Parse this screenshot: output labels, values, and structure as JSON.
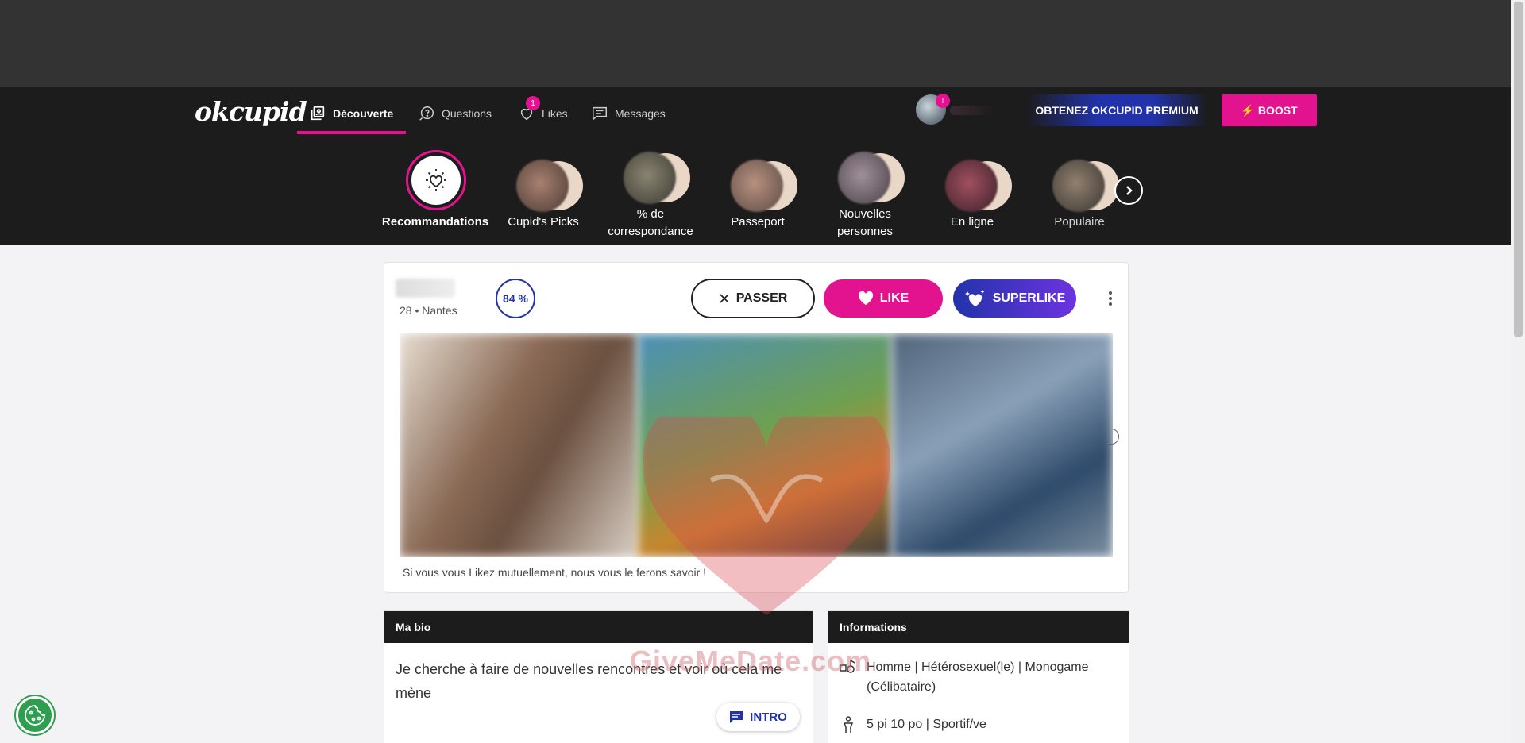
{
  "nav": {
    "logo": "okcupid",
    "items": [
      {
        "label": "Découverte",
        "icon": "discover-icon"
      },
      {
        "label": "Questions",
        "icon": "questions-icon"
      },
      {
        "label": "Likes",
        "icon": "likes-icon",
        "badge": "1"
      },
      {
        "label": "Messages",
        "icon": "messages-icon"
      }
    ],
    "avatar_badge": "!",
    "premium_label": "OBTENEZ OKCUPID PREMIUM",
    "boost_label": "BOOST"
  },
  "categories": [
    {
      "label": "Recommandations",
      "selected": true
    },
    {
      "label": "Cupid's Picks"
    },
    {
      "label": "% de correspondance"
    },
    {
      "label": "Passeport"
    },
    {
      "label": "Nouvelles personnes"
    },
    {
      "label": "En ligne"
    },
    {
      "label": "Populaire"
    }
  ],
  "profile": {
    "meta": "28 • Nantes",
    "match": "84 %",
    "pass_label": "PASSER",
    "like_label": "LIKE",
    "superlike_label": "SUPERLIKE",
    "mutual_note": "Si vous vous Likez mutuellement, nous vous le ferons savoir !"
  },
  "bio": {
    "title": "Ma bio",
    "text": "Je cherche à faire de nouvelles rencontres et voir où cela me mène",
    "intro_label": "INTRO"
  },
  "info": {
    "title": "Informations",
    "rows": [
      {
        "icon": "gender-icon",
        "text": "Homme | Hétérosexuel(le) | Monogame (Célibataire)"
      },
      {
        "icon": "body-icon",
        "text": "5 pi 10 po | Sportif/ve"
      }
    ]
  },
  "watermark": "GiveMeDate.com",
  "colors": {
    "accent": "#e3138f",
    "blue": "#2233aa",
    "dark": "#1c1c1c"
  }
}
